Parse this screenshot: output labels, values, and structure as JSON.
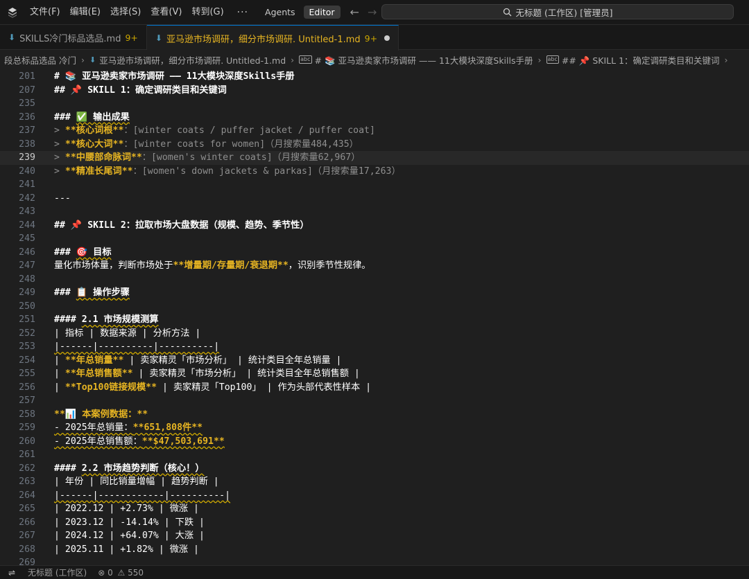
{
  "menu": {
    "items": [
      "文件(F)",
      "编辑(E)",
      "选择(S)",
      "查看(V)",
      "转到(G)"
    ],
    "more": "···",
    "agents": "Agents",
    "editor": "Editor"
  },
  "search": {
    "text": "无标题 (工作区) [管理员]"
  },
  "tabs": [
    {
      "label": "SKILLS冷门标品选品.md",
      "badge": "9+"
    },
    {
      "label": "亚马逊市场调研，细分市场调研. Untitled-1.md",
      "badge": "9+"
    }
  ],
  "breadcrumb": {
    "items": [
      "段总标品选品 冷门",
      "亚马逊市场调研，细分市场调研. Untitled-1.md",
      "# 📚 亚马逊卖家市场调研 —— 11大模块深度Skills手册",
      "## 📌 SKILL 1：确定调研类目和关键词"
    ]
  },
  "editor": {
    "lines": [
      {
        "n": "201",
        "text": "# 📚 亚马逊卖家市场调研 —— 11大模块深度Skills手册"
      },
      {
        "n": "207",
        "text": "## 📌 SKILL 1：确定调研类目和关键词"
      },
      {
        "n": "235",
        "text": ""
      },
      {
        "n": "236",
        "text": "### ✅ 输出成果"
      },
      {
        "n": "237",
        "text": "> **核心词根**：[winter coats / puffer jacket / puffer coat]"
      },
      {
        "n": "238",
        "text": "> **核心大词**：[winter coats for women]（月搜索量484,435）"
      },
      {
        "n": "239",
        "text": "> **中腰部命脉词**：[women's winter coats]（月搜索量62,967）"
      },
      {
        "n": "240",
        "text": "> **精准长尾词**：[women's down jackets & parkas]（月搜索量17,263）"
      },
      {
        "n": "241",
        "text": ""
      },
      {
        "n": "242",
        "text": "---"
      },
      {
        "n": "243",
        "text": ""
      },
      {
        "n": "244",
        "text": "## 📌 SKILL 2：拉取市场大盘数据（规模、趋势、季节性）"
      },
      {
        "n": "245",
        "text": ""
      },
      {
        "n": "246",
        "text": "### 🎯 目标"
      },
      {
        "n": "247",
        "text": "量化市场体量，判断市场处于**增量期/存量期/衰退期**，识别季节性规律。"
      },
      {
        "n": "248",
        "text": ""
      },
      {
        "n": "249",
        "text": "### 📋 操作步骤"
      },
      {
        "n": "250",
        "text": ""
      },
      {
        "n": "251",
        "text": "#### 2.1 市场规模测算"
      },
      {
        "n": "252",
        "text": "| 指标 | 数据来源 | 分析方法 |"
      },
      {
        "n": "253",
        "text": "|------|----------|----------|"
      },
      {
        "n": "254",
        "text": "| **年总销量** | 卖家精灵「市场分析」 | 统计类目全年总销量 |"
      },
      {
        "n": "255",
        "text": "| **年总销售额** | 卖家精灵「市场分析」 | 统计类目全年总销售额 |"
      },
      {
        "n": "256",
        "text": "| **Top100链接规模** | 卖家精灵「Top100」 | 作为头部代表性样本 |"
      },
      {
        "n": "257",
        "text": ""
      },
      {
        "n": "258",
        "text": "**📊 本案例数据：**"
      },
      {
        "n": "259",
        "text": "- 2025年总销量：**651,808件**"
      },
      {
        "n": "260",
        "text": "- 2025年总销售额：**$47,503,691**"
      },
      {
        "n": "261",
        "text": ""
      },
      {
        "n": "262",
        "text": "#### 2.2 市场趋势判断（核心！）"
      },
      {
        "n": "263",
        "text": "| 年份 | 同比销量增幅 | 趋势判断 |"
      },
      {
        "n": "264",
        "text": "|------|------------|----------|"
      },
      {
        "n": "265",
        "text": "| 2022.12 | +2.73% | 微涨 |"
      },
      {
        "n": "266",
        "text": "| 2023.12 | -14.14% | 下跌 |"
      },
      {
        "n": "267",
        "text": "| 2024.12 | +64.07% | 大涨 |"
      },
      {
        "n": "268",
        "text": "| 2025.11 | +1.82% | 微涨 |"
      },
      {
        "n": "269",
        "text": ""
      }
    ],
    "current_line": "239"
  },
  "status": {
    "workspace": "无标题 (工作区)",
    "errors": "0",
    "warnings": "550"
  },
  "colors": {
    "accent": "#0078d4",
    "bold": "#e6b422",
    "background": "#1f1f1f"
  }
}
